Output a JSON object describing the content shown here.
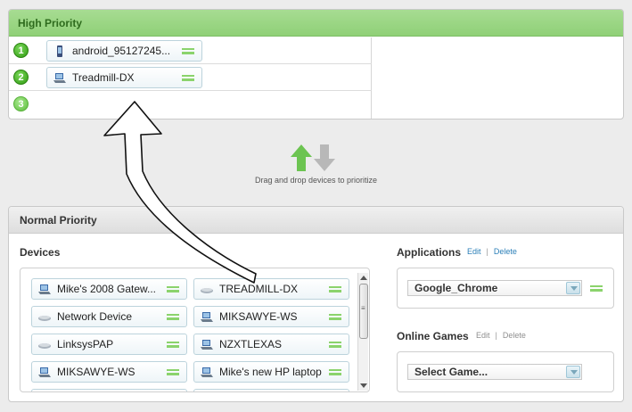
{
  "high_priority": {
    "title": "High Priority",
    "slots": [
      {
        "number": "1",
        "device": "android_95127245...",
        "icon": "phone-icon"
      },
      {
        "number": "2",
        "device": "Treadmill-DX",
        "icon": "laptop-icon"
      },
      {
        "number": "3",
        "device": "",
        "icon": ""
      }
    ]
  },
  "drag_hint": "Drag and drop devices to prioritize",
  "normal_priority": {
    "title": "Normal Priority",
    "devices_title": "Devices",
    "devices": [
      {
        "label": "Mike's 2008 Gatew...",
        "icon": "laptop-icon"
      },
      {
        "label": "TREADMILL-DX",
        "icon": "router-icon"
      },
      {
        "label": "Network Device",
        "icon": "router-icon"
      },
      {
        "label": "MIKSAWYE-WS",
        "icon": "laptop-icon"
      },
      {
        "label": "LinksysPAP",
        "icon": "router-icon"
      },
      {
        "label": "NZXTLEXAS",
        "icon": "laptop-icon"
      },
      {
        "label": "MIKSAWYE-WS",
        "icon": "laptop-icon"
      },
      {
        "label": "Mike's new HP laptop",
        "icon": "laptop-icon"
      }
    ],
    "applications": {
      "title": "Applications",
      "edit": "Edit",
      "separator": "|",
      "delete": "Delete",
      "selected": "Google_Chrome"
    },
    "online_games": {
      "title": "Online Games",
      "edit": "Edit",
      "separator": "|",
      "delete": "Delete",
      "selected": "Select Game..."
    }
  },
  "colors": {
    "accent_green": "#8bd36c",
    "link_blue": "#2b7fb8",
    "header_green": "#9ad681"
  }
}
